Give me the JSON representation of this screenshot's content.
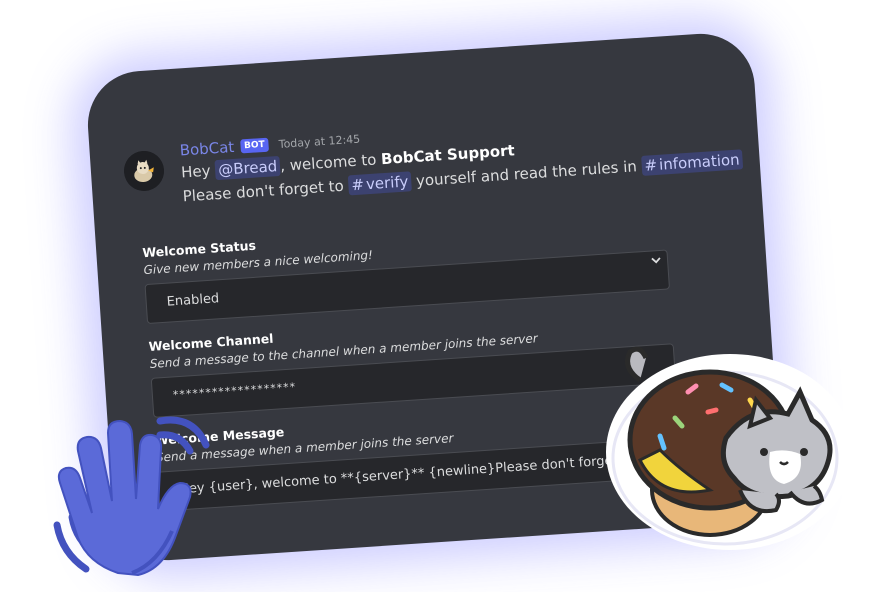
{
  "message": {
    "author": "BobCat",
    "tag": "BOT",
    "timestamp": "Today at 12:45",
    "greeting": "Hey",
    "mention": "@Bread",
    "welcome_text": ", welcome to",
    "server_name": "BobCat Support",
    "line2_prefix": "Please don't forget to",
    "channel_verify": "verify",
    "line2_middle": "yourself and read the rules in",
    "channel_info": "infomation"
  },
  "fields": [
    {
      "title": "Welcome Status",
      "description": "Give new members a nice welcoming!",
      "value": "Enabled"
    },
    {
      "title": "Welcome Channel",
      "description": "Send a message to the channel when a member joins the server",
      "value": "*******************"
    },
    {
      "title": "Welcome Message",
      "description": "Send a message when a member joins the server",
      "value": "Hey {user}, welcome to **{server}** {newline}Please don't forget to"
    }
  ],
  "colors": {
    "card": "#36383f",
    "accent": "#5865f2",
    "username": "#7a86e8",
    "mention_bg": "#3c4270",
    "input_bg": "#26272b"
  },
  "icons": {
    "avatar": "bobcat-avatar-icon",
    "chevron": "chevron-down-icon",
    "hash": "hash-icon",
    "hand": "waving-hand-icon",
    "sticker": "cat-donut-sticker"
  }
}
